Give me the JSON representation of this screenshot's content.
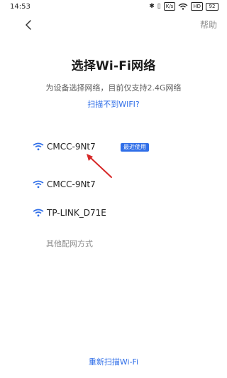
{
  "statusbar": {
    "time": "14:53",
    "icons": [
      "bluetooth-icon",
      "vibrate-icon",
      "network-speed-icon",
      "wifi-icon",
      "hd-icon",
      "battery-icon"
    ],
    "battery": "92"
  },
  "topbar": {
    "help_label": "帮助"
  },
  "page": {
    "title": "选择Wi-Fi网络",
    "subtitle": "为设备选择网络，目前仅支持2.4G网络",
    "cant_find_link": "扫描不到WIFI?"
  },
  "networks": [
    {
      "ssid": "CMCC-9Nt7",
      "badge": "最近使用"
    },
    {
      "ssid": "CMCC-9Nt7"
    },
    {
      "ssid": "TP-LINK_D71E"
    }
  ],
  "other_methods": "其他配网方式",
  "rescan_label": "重新扫描Wi-Fi",
  "colors": {
    "accent": "#2f6ee8",
    "annotation_arrow": "#d62828",
    "muted_text": "#8d8d8d"
  }
}
